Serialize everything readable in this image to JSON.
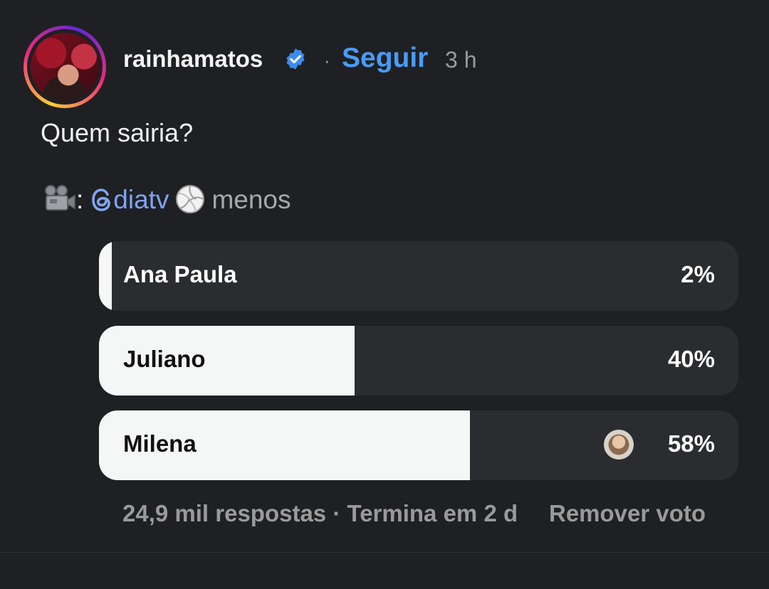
{
  "post": {
    "username": "rainhamatos",
    "follow_label": "Seguir",
    "separator": "·",
    "time": "3 h",
    "question": "Quem sairia?",
    "credit": {
      "camera_icon": "movie-camera-emoji",
      "colon": ":",
      "mention": "diatv",
      "ball_icon": "volleyball-emoji",
      "suffix": "menos"
    }
  },
  "poll": {
    "options": [
      {
        "label": "Ana Paula",
        "percent_label": "2%",
        "percent": 2
      },
      {
        "label": "Juliano",
        "percent_label": "40%",
        "percent": 40
      },
      {
        "label": "Milena",
        "percent_label": "58%",
        "percent": 58,
        "voted": true
      }
    ],
    "footer": "24,9 mil respostas · Termina em 2 d",
    "remove_vote_label": "Remover voto"
  },
  "colors": {
    "background": "#1f2023",
    "accent": "#4a9bf5",
    "mention": "#7fa4f0",
    "bar_fill": "#f5f7f6",
    "bar_track": "#2b2c30"
  }
}
